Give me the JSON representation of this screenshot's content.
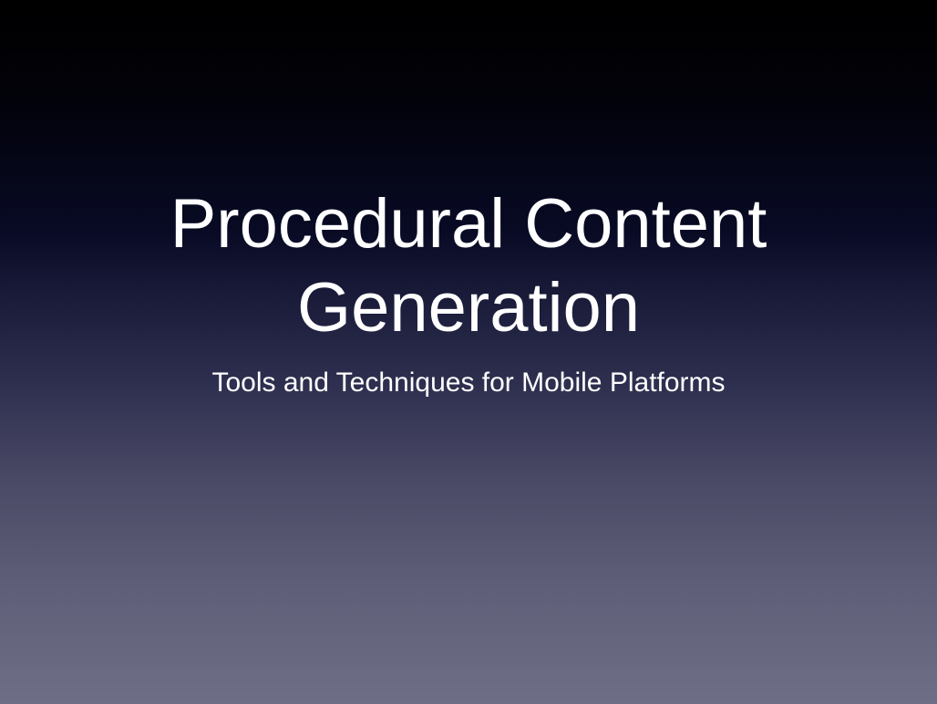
{
  "slide": {
    "title_line_1": "Procedural Content",
    "title_line_2": "Generation",
    "subtitle": "Tools and Techniques for Mobile Platforms"
  },
  "colors": {
    "text": "#ffffff",
    "background_top": "#000000",
    "background_bottom": "#6e6e86"
  }
}
